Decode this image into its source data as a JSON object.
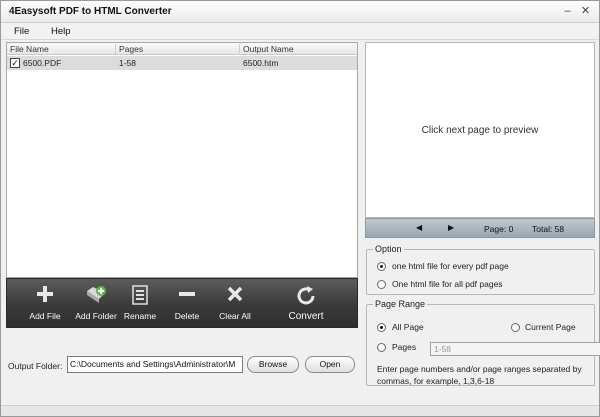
{
  "window": {
    "title": "4Easysoft PDF to HTML Converter"
  },
  "menu": [
    "File",
    "Help"
  ],
  "file_list": {
    "columns": [
      "File Name",
      "Pages",
      "Output Name"
    ],
    "rows": [
      {
        "checked": true,
        "name": "6500.PDF",
        "pages": "1-58",
        "output": "6500.htm"
      }
    ]
  },
  "toolbar": {
    "add_file": "Add File",
    "add_folder": "Add Folder",
    "rename": "Rename",
    "delete": "Delete",
    "clear_all": "Clear All",
    "convert": "Convert"
  },
  "output": {
    "label": "Output Folder:",
    "path": "C:\\Documents and Settings\\Administrator\\M",
    "browse": "Browse",
    "open": "Open"
  },
  "preview": {
    "message": "Click next page to preview",
    "page_label": "Page: 0",
    "total_label": "Total: 58"
  },
  "option": {
    "legend": "Option",
    "choices": [
      "one html file for every pdf page",
      "One html file for all pdf pages"
    ],
    "selected": 0
  },
  "page_range": {
    "legend": "Page Range",
    "all_page": "All Page",
    "current_page": "Current Page",
    "pages": "Pages",
    "pages_value": "1-58",
    "hint": "Enter page numbers and/or page ranges separated by commas, for example, 1,3,6-18"
  }
}
